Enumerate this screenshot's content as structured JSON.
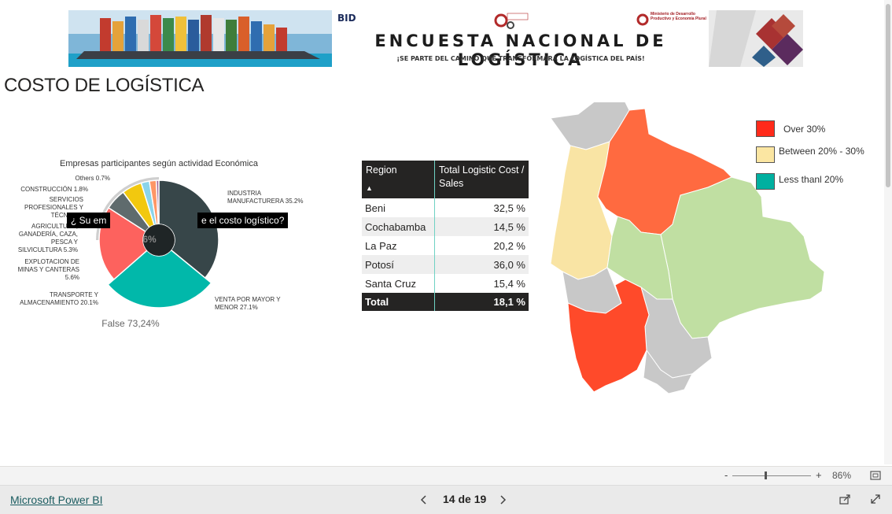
{
  "banner": {
    "title": "ENCUESTA NACIONAL DE LOGÍSTICA",
    "subtitle": "¡SE PARTE DEL CAMINO QUE TRANSFORMARÁ LA LOGÍSTICA DEL PAÍS!",
    "logo_bid": "BID",
    "logo_mid": "LOGÍSTICA",
    "logo_ministry": "Ministerio de Desarrollo Productivo y Economía Plural"
  },
  "page_title": "COSTO DE LOGÍSTICA",
  "donut": {
    "title": "Empresas participantes según actividad Económica",
    "center_label": "6%",
    "false_label": "False 73,24%",
    "tooltip_left": "¿ Su em",
    "tooltip_right": "e el costo logístico?",
    "labels": {
      "industria": "INDUSTRIA MANUFACTURERA 35.2%",
      "venta": "VENTA POR MAYOR Y MENOR 27.1%",
      "transporte": "TRANSPORTE Y ALMACENAMIENTO 20.1%",
      "minas": "EXPLOTACION DE MINAS Y CANTERAS 5.6%",
      "agri": "AGRICULTURA, GANADERÍA, CAZA, PESCA Y SILVICULTURA 5.3%",
      "servicios": "SERVICIOS PROFESIONALES Y TÉCNICOS",
      "construccion": "CONSTRUCCIÓN 1.8%",
      "others": "Others 0.7%"
    }
  },
  "chart_data": {
    "type": "pie",
    "title": "Empresas participantes según actividad Económica",
    "categories": [
      "INDUSTRIA MANUFACTURERA",
      "VENTA POR MAYOR Y MENOR",
      "TRANSPORTE Y ALMACENAMIENTO",
      "EXPLOTACION DE MINAS Y CANTERAS",
      "AGRICULTURA, GANADERÍA, CAZA, PESCA Y SILVICULTURA",
      "SERVICIOS PROFESIONALES Y TÉCNICOS",
      "CONSTRUCCIÓN",
      "Others"
    ],
    "values": [
      35.2,
      27.1,
      20.1,
      5.6,
      5.3,
      2.2,
      1.8,
      0.7
    ],
    "colors": [
      "#374649",
      "#01b8aa",
      "#fd625e",
      "#5f6b6d",
      "#f2c80f",
      "#8ad4eb",
      "#fe9666",
      "#a66999"
    ]
  },
  "table": {
    "headers": [
      "Region",
      "Total Logistic Cost / Sales"
    ],
    "rows": [
      [
        "Beni",
        "32,5 %"
      ],
      [
        "Cochabamba",
        "14,5 %"
      ],
      [
        "La Paz",
        "20,2 %"
      ],
      [
        "Potosí",
        "36,0 %"
      ],
      [
        "Santa Cruz",
        "15,4 %"
      ]
    ],
    "total": [
      "Total",
      "18,1 %"
    ]
  },
  "legend": {
    "items": [
      {
        "label": "Over 30%",
        "color": "#ff2a1a"
      },
      {
        "label": "Between 20% - 30%",
        "color": "#fbe6a2"
      },
      {
        "label": "Less thanl 20%",
        "color": "#00b0a0"
      }
    ]
  },
  "map_colors": {
    "over": "#ff4a2a",
    "orange": "#ff6a40",
    "between": "#f9e4a4",
    "less": "#c0dfa2",
    "nodata": "#c8c8c8"
  },
  "footer": {
    "brand": "Microsoft Power BI",
    "page": "14 de 19",
    "zoom": "86%",
    "zoom_minus": "-",
    "zoom_plus": "+"
  }
}
